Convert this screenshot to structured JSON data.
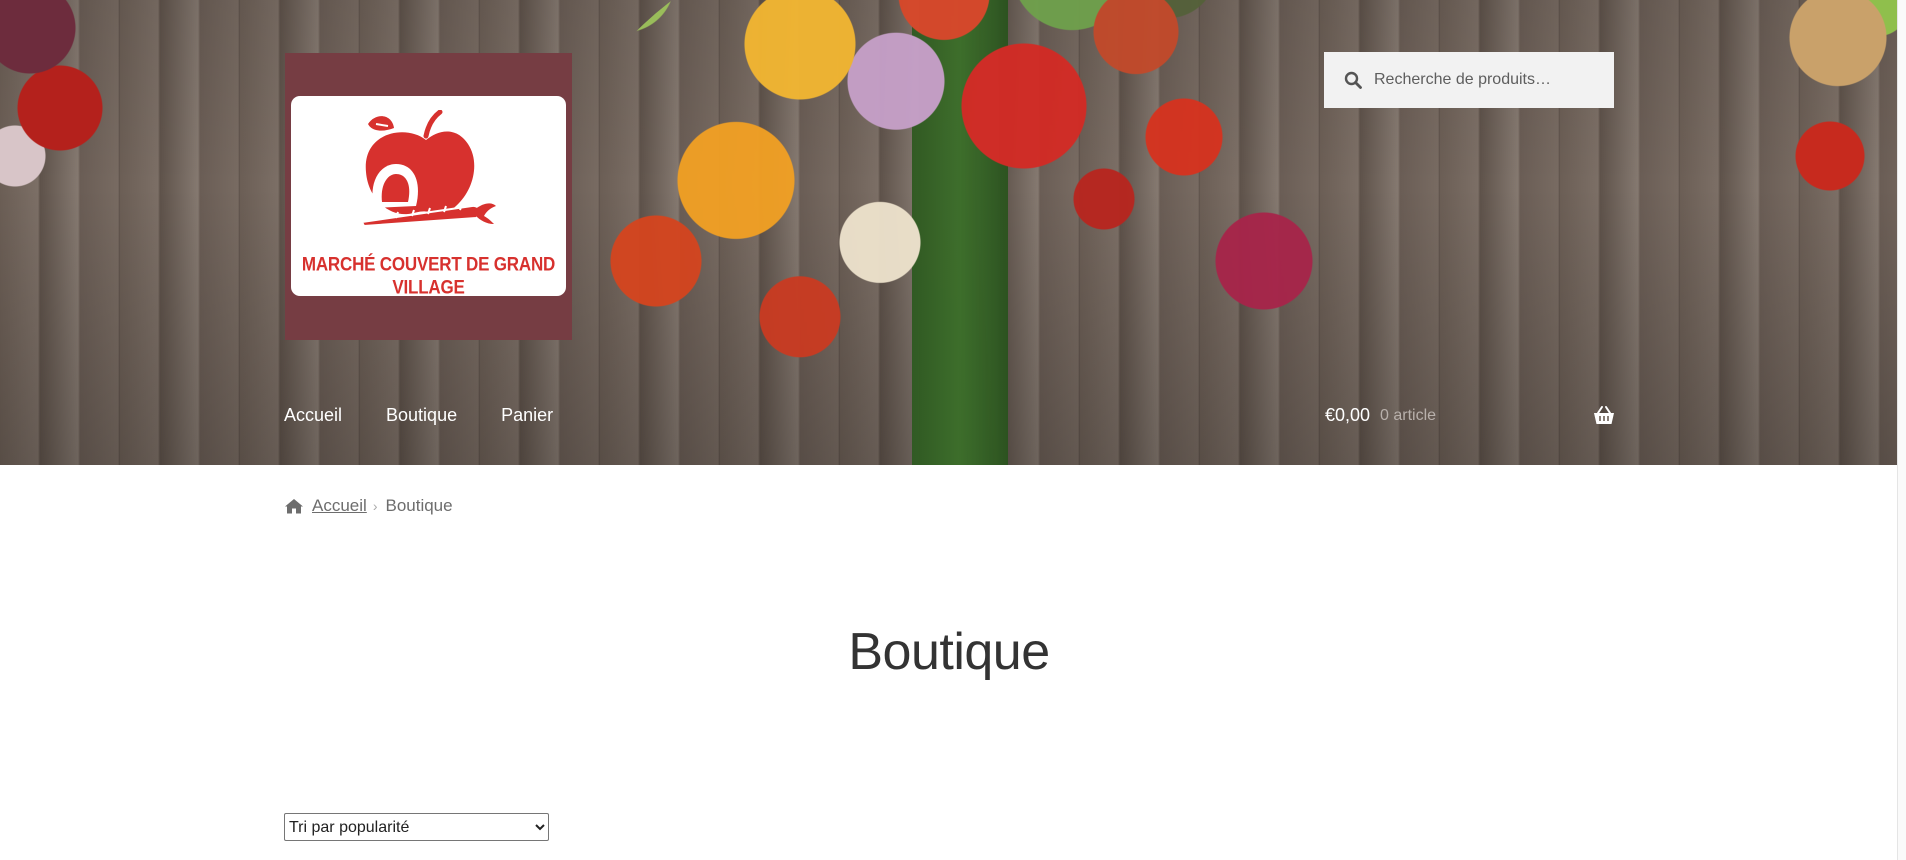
{
  "header": {
    "logo_text": "MARCHÉ COUVERT DE GRAND VILLAGE",
    "colors": {
      "logo_box": "#763d43",
      "logo_red": "#d7312e"
    }
  },
  "search": {
    "placeholder": "Recherche de produits…",
    "icon": "search-icon"
  },
  "nav": {
    "items": [
      {
        "label": "Accueil"
      },
      {
        "label": "Boutique"
      },
      {
        "label": "Panier"
      }
    ]
  },
  "cart": {
    "amount": "€0,00",
    "count": "0 article",
    "icon": "basket-icon"
  },
  "breadcrumb": {
    "home_icon": "home-icon",
    "home": "Accueil",
    "current": "Boutique"
  },
  "main": {
    "title": "Boutique"
  },
  "sort": {
    "selected": "Tri par popularité"
  }
}
